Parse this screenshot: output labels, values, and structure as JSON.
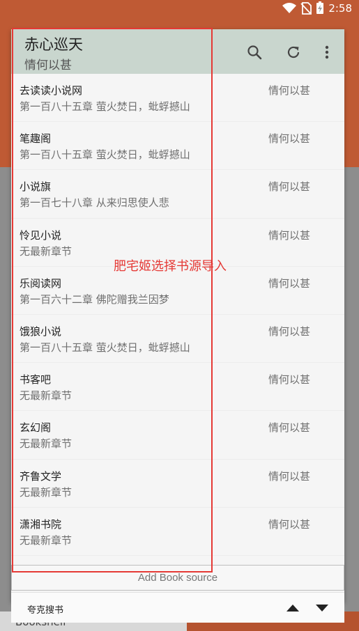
{
  "status_bar": {
    "time": "2:58"
  },
  "background": {
    "tab_label": "Bookshelf"
  },
  "dialog": {
    "title": "赤心巡天",
    "subtitle": "情何以甚",
    "actions": {
      "search": "search-icon",
      "refresh": "refresh-icon",
      "more": "more-vert-icon"
    },
    "sources": [
      {
        "name": "去读读小说网",
        "chapter": "第一百八十五章 萤火焚日，蚍蜉撼山",
        "author": "情何以甚"
      },
      {
        "name": "笔趣阁",
        "chapter": "第一百八十五章 萤火焚日，蚍蜉撼山",
        "author": "情何以甚"
      },
      {
        "name": "小说旗",
        "chapter": "第一百七十八章 从来归思使人悲",
        "author": "情何以甚"
      },
      {
        "name": "怜见小说",
        "chapter": "无最新章节",
        "author": "情何以甚"
      },
      {
        "name": "乐阅读网",
        "chapter": "第一百六十二章 佛陀赠我兰因梦",
        "author": "情何以甚"
      },
      {
        "name": "饿狼小说",
        "chapter": "第一百八十五章 萤火焚日，蚍蜉撼山",
        "author": "情何以甚"
      },
      {
        "name": "书客吧",
        "chapter": "无最新章节",
        "author": "情何以甚"
      },
      {
        "name": "玄幻阁",
        "chapter": "无最新章节",
        "author": "情何以甚"
      },
      {
        "name": "齐鲁文学",
        "chapter": "无最新章节",
        "author": "情何以甚"
      },
      {
        "name": "潇湘书院",
        "chapter": "无最新章节",
        "author": "情何以甚"
      }
    ],
    "add_source_label": "Add Book source",
    "bottom": {
      "label": "夸克搜书"
    }
  },
  "annotation": {
    "text": "肥宅姬选择书源导入",
    "color": "#e53935"
  },
  "colors": {
    "header": "#c9d6ce",
    "accent_bg": "#bf5a34"
  }
}
